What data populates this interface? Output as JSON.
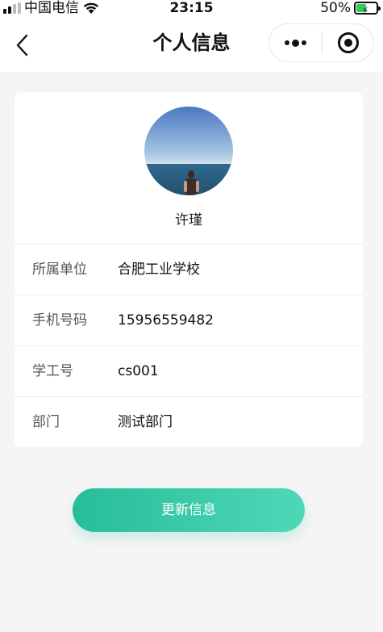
{
  "status_bar": {
    "carrier": "中国电信",
    "time": "23:15",
    "battery_percent": "50%",
    "battery_level": 0.5,
    "icons": [
      "signal-icon",
      "wifi-icon",
      "battery-charging-icon"
    ]
  },
  "nav": {
    "title": "个人信息",
    "back_icon": "chevron-left-icon",
    "more_icon": "more-dots-icon",
    "close_icon": "target-circle-icon"
  },
  "profile": {
    "name": "许瑾",
    "fields": [
      {
        "label": "所属单位",
        "value": "合肥工业学校"
      },
      {
        "label": "手机号码",
        "value": "15956559482"
      },
      {
        "label": "学工号",
        "value": "cs001"
      },
      {
        "label": "部门",
        "value": "测试部门"
      }
    ]
  },
  "actions": {
    "update_label": "更新信息"
  },
  "colors": {
    "accent_start": "#27bd9a",
    "accent_end": "#4fd8b8",
    "page_bg": "#f5f5f5"
  }
}
